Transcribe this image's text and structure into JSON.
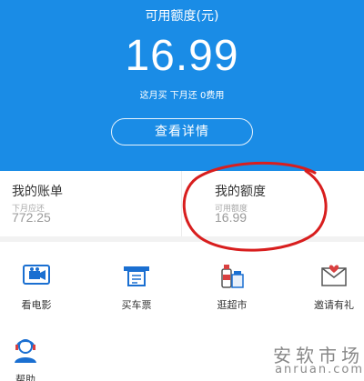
{
  "hero": {
    "label": "可用额度(元)",
    "amount": "16.99",
    "summary": "这月买 下月还 0费用",
    "detail_button": "查看详情",
    "background_color": "#1a8ce6"
  },
  "cards": {
    "bill": {
      "title": "我的账单",
      "sublabel": "下月应还",
      "value": "772.25"
    },
    "quota": {
      "title": "我的额度",
      "sublabel": "可用额度",
      "value": "16.99"
    },
    "annotation_color": "#d81e1e"
  },
  "services": [
    {
      "label": "看电影",
      "icon": "movie-icon"
    },
    {
      "label": "买车票",
      "icon": "ticket-icon"
    },
    {
      "label": "逛超市",
      "icon": "supermarket-icon"
    },
    {
      "label": "邀请有礼",
      "icon": "invite-gift-icon"
    },
    {
      "label": "帮助",
      "icon": "help-icon"
    }
  ],
  "watermark": {
    "cn": "安软市场",
    "en": "anruan.com"
  }
}
